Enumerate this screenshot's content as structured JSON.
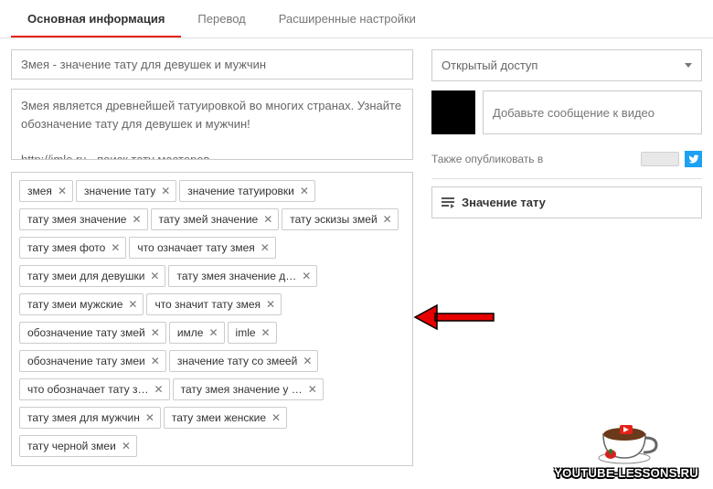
{
  "tabs": [
    {
      "label": "Основная информация",
      "active": true
    },
    {
      "label": "Перевод",
      "active": false
    },
    {
      "label": "Расширенные настройки",
      "active": false
    }
  ],
  "title_value": "Змея - значение тату для девушек и мужчин",
  "description_value": "Змея является древнейшей татуировкой во многих странах. Узнайте обозначение тату для девушек и мужчин!\n\nhttp://imle.ru - поиск тату мастеров",
  "tags": [
    "змея",
    "значение тату",
    "значение татуировки",
    "тату змея значение",
    "тату змей значение",
    "тату эскизы змей",
    "тату змея фото",
    "что означает тату змея",
    "тату змеи для девушки",
    "тату змея значение д…",
    "тату змеи мужские",
    "что значит тату змея",
    "обозначение тату змей",
    "имле",
    "imle",
    "обозначение тату змеи",
    "значение тату со змеей",
    "что обозначает тату з…",
    "тату змея значение у …",
    "тату змея для мужчин",
    "тату змеи женские",
    "тату черной змеи"
  ],
  "privacy": {
    "label": "Открытый доступ"
  },
  "message_placeholder": "Добавьте сообщение к видео",
  "share_label": "Также опубликовать в",
  "playlist_label": "Значение тату",
  "watermark": "YOUTUBE-LESSONS.RU"
}
